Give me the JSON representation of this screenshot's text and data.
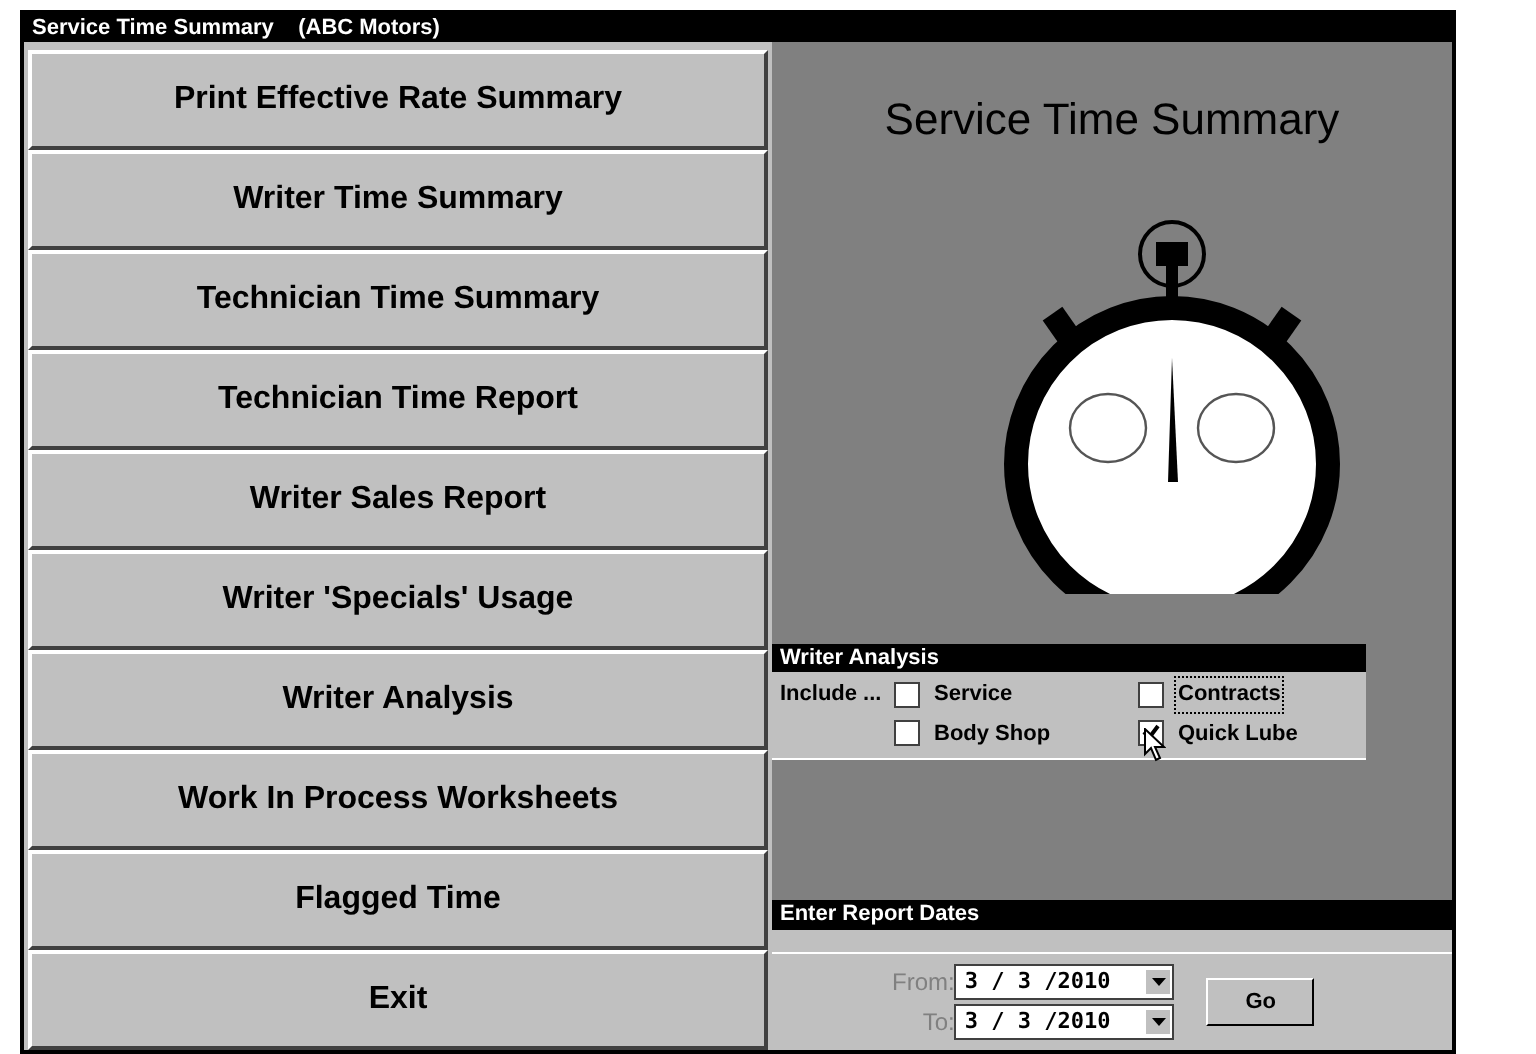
{
  "window": {
    "title": "Service Time Summary    (ABC Motors)"
  },
  "menu_buttons": [
    "Print Effective Rate Summary",
    "Writer Time Summary",
    "Technician Time Summary",
    "Technician Time Report",
    "Writer Sales Report",
    "Writer 'Specials' Usage",
    "Writer Analysis",
    "Work In Process Worksheets",
    "Flagged Time",
    "Exit"
  ],
  "heading": "Service Time Summary",
  "writer_analysis": {
    "title": "Writer Analysis",
    "include_label": "Include ...",
    "options": [
      {
        "label": "Service",
        "checked": false,
        "focused": false
      },
      {
        "label": "Contracts",
        "checked": false,
        "focused": true
      },
      {
        "label": "Body Shop",
        "checked": false,
        "focused": false
      },
      {
        "label": "Quick Lube",
        "checked": true,
        "focused": false
      }
    ]
  },
  "report_dates": {
    "title": "Enter Report Dates",
    "from_label": "From:",
    "from_value": "3 / 3 /2010",
    "to_label": "To:",
    "to_value": "3 / 3 /2010",
    "go_button": "Go"
  }
}
